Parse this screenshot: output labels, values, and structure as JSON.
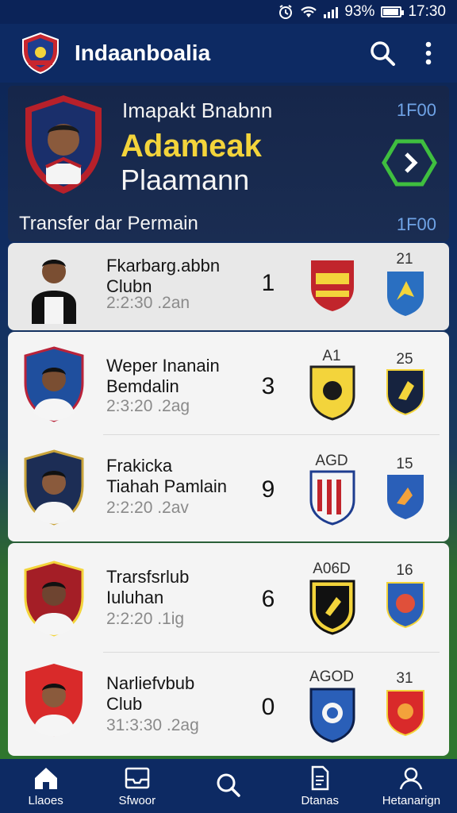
{
  "status_bar": {
    "battery": "93%",
    "time": "17:30",
    "battery_level": 0.93
  },
  "app_bar": {
    "title": "Indaanboalia",
    "icons": [
      "club-logo-icon",
      "search-icon",
      "more-vert-icon"
    ]
  },
  "hero": {
    "line1": "Imapakt Bnabnn",
    "line2": "Adameak",
    "line3": "Plaamann",
    "count": "1F00",
    "section_title": "Transfer dar Permain",
    "section_count": "1F00",
    "next_icon": "chevron-right-icon"
  },
  "transfers": [
    {
      "name1": "Fkarbarg.abbn",
      "name2": "Clubn",
      "date": "2:2:30 .2an",
      "number": "1",
      "from_label": "",
      "to_label": "21"
    },
    {
      "name1": "Weper Inanain",
      "name2": "Bemdalin",
      "date": "2:3:20 .2ag",
      "number": "3",
      "from_label": "A1",
      "to_label": "25"
    },
    {
      "name1": "Frakicka",
      "name2": "Tiahah Pamlain",
      "date": "2:2:20 .2av",
      "number": "9",
      "from_label": "AGD",
      "to_label": "15"
    },
    {
      "name1": "Trarsfsrlub",
      "name2": "Iuluhan",
      "date": "2:2:20 .1ig",
      "number": "6",
      "from_label": "A06D",
      "to_label": "16"
    },
    {
      "name1": "Narliefvbub",
      "name2": "Club",
      "date": "31:3:30 .2ag",
      "number": "0",
      "from_label": "AGOD",
      "to_label": "31"
    }
  ],
  "bottom_nav": [
    {
      "label": "Llaoes",
      "icon": "home-icon"
    },
    {
      "label": "Sfwoor",
      "icon": "inbox-icon"
    },
    {
      "label": "",
      "icon": "search-icon"
    },
    {
      "label": "Dtanas",
      "icon": "document-icon"
    },
    {
      "label": "Hetanarign",
      "icon": "profile-icon"
    }
  ],
  "colors": {
    "primary": "#0d2a63",
    "hero_bg": "#16264a",
    "accent_yellow": "#f3d43b",
    "accent_green": "#3fbf3f",
    "count_blue": "#6fa3e6"
  }
}
